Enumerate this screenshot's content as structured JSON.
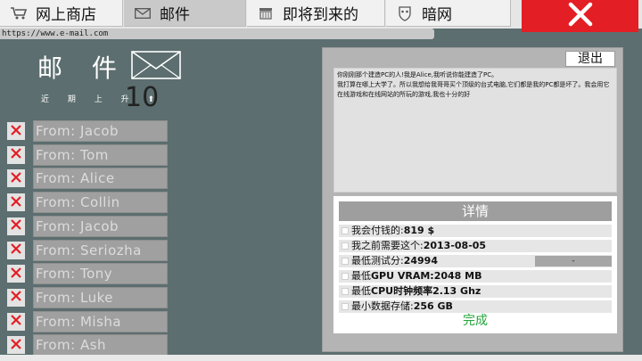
{
  "tabs": [
    {
      "label": "网上商店",
      "icon": "cart-icon"
    },
    {
      "label": "邮件",
      "icon": "envelope-icon"
    },
    {
      "label": "即将到来的",
      "icon": "calendar-icon"
    },
    {
      "label": "暗网",
      "icon": "mask-icon"
    }
  ],
  "url": "https://www.e-mail.com",
  "mail": {
    "title": "邮 件",
    "sort_label": "近 期 上 升 ⬆",
    "count": "10",
    "senders": [
      "From: Jacob",
      "From: Tom",
      "From: Alice",
      "From: Collin",
      "From: Jacob",
      "From: Seriozha",
      "From: Tony",
      "From: Luke",
      "From: Misha",
      "From: Ash"
    ]
  },
  "message": {
    "logout_label": "退出",
    "line1": "你刚刚那个建造PC的人!我是Alice,我听说你能建造了PC。",
    "line2": "我打算在哪上大学了。所以我想给我哥哥买个顶级的台式电脑,它们都是我的PC都是坏了。我会用它",
    "line3": "在线游戏和在线网站的所玩的游戏,我也十分的好"
  },
  "details": {
    "header": "详情",
    "requirements": [
      {
        "label": "我会付钱的:",
        "value": "819 $",
        "bar": ""
      },
      {
        "label": "我之前需要这个:",
        "value": "2013-08-05",
        "bar": ""
      },
      {
        "label": "最低测试分:",
        "value": "24994",
        "bar": "-"
      },
      {
        "label": "最低",
        "value": "GPU VRAM:2048 MB",
        "bar": ""
      },
      {
        "label": "最低",
        "value": "CPU时钟频率2.13 Ghz",
        "bar": ""
      },
      {
        "label": "最小数据存储:",
        "value": "256 GB",
        "bar": ""
      }
    ],
    "done_label": "完成"
  },
  "colors": {
    "background": "#5c6e6f",
    "close_button": "#e31e24",
    "done_text": "#23a43a"
  }
}
